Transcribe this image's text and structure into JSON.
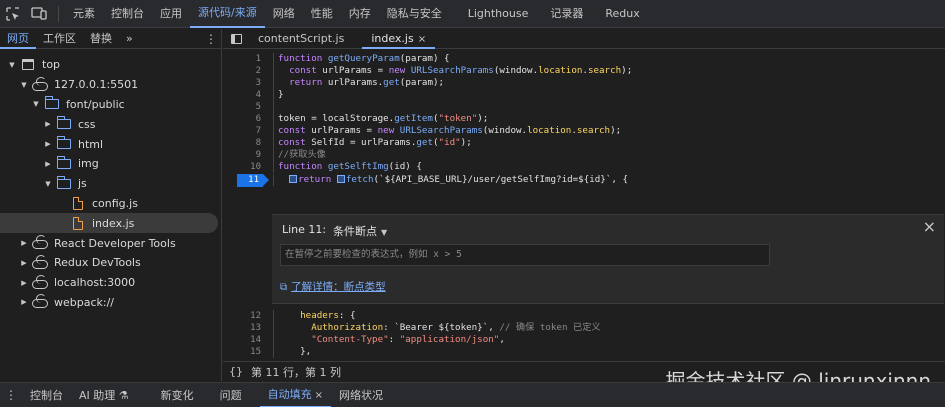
{
  "toolbar": {
    "tabs": [
      {
        "label": "元素"
      },
      {
        "label": "控制台"
      },
      {
        "label": "应用"
      },
      {
        "label": "源代码/来源"
      },
      {
        "label": "网络"
      },
      {
        "label": "性能"
      },
      {
        "label": "内存"
      },
      {
        "label": "隐私与安全"
      },
      {
        "label": "Lighthouse"
      },
      {
        "label": "记录器"
      },
      {
        "label": "Redux"
      }
    ],
    "active_tab": "源代码/来源",
    "icons": [
      "inspect-element-icon",
      "device-toolbar-icon"
    ]
  },
  "navigator": {
    "tabs": [
      {
        "label": "网页"
      },
      {
        "label": "工作区"
      },
      {
        "label": "替换"
      }
    ],
    "more_label": "»",
    "menu_label": "⋮",
    "tree": [
      {
        "label": "top",
        "icon": "frame-icon",
        "arrow": "down"
      },
      {
        "label": "127.0.0.1:5501",
        "icon": "cloud-icon",
        "arrow": "down"
      },
      {
        "label": "font/public",
        "icon": "folder-icon",
        "arrow": "down"
      },
      {
        "label": "css",
        "icon": "folder-icon",
        "arrow": "right"
      },
      {
        "label": "html",
        "icon": "folder-icon",
        "arrow": "right"
      },
      {
        "label": "img",
        "icon": "folder-icon",
        "arrow": "right"
      },
      {
        "label": "js",
        "icon": "folder-icon",
        "arrow": "down"
      },
      {
        "label": "config.js",
        "icon": "file-icon",
        "arrow": ""
      },
      {
        "label": "index.js",
        "icon": "file-icon",
        "arrow": "",
        "selected": true
      },
      {
        "label": "React Developer Tools",
        "icon": "cloud-icon",
        "arrow": "right"
      },
      {
        "label": "Redux DevTools",
        "icon": "cloud-icon",
        "arrow": "right"
      },
      {
        "label": "localhost:3000",
        "icon": "cloud-icon",
        "arrow": "right"
      },
      {
        "label": "webpack://",
        "icon": "cloud-icon",
        "arrow": "right"
      }
    ]
  },
  "editor": {
    "tabs": [
      {
        "label": "contentScript.js",
        "closable": false
      },
      {
        "label": "index.js",
        "closable": true,
        "active": true
      }
    ],
    "close_glyph": "×",
    "lines": [
      {
        "n": "1",
        "text": "function getQueryParam(param) {"
      },
      {
        "n": "2",
        "text": "  const urlParams = new URLSearchParams(window.location.search);"
      },
      {
        "n": "3",
        "text": "  return urlParams.get(param);"
      },
      {
        "n": "4",
        "text": "}"
      },
      {
        "n": "5",
        "text": ""
      },
      {
        "n": "6",
        "text": "token = localStorage.getItem(\"token\");"
      },
      {
        "n": "7",
        "text": "const urlParams = new URLSearchParams(window.location.search);"
      },
      {
        "n": "8",
        "text": "const SelfId = urlParams.get(\"id\");"
      },
      {
        "n": "9",
        "text": "//获取头像"
      },
      {
        "n": "10",
        "text": "function getSelftImg(id) {"
      },
      {
        "n": "11",
        "text": "  return fetch(`${API_BASE_URL}/user/getSelfImg?id=${id}`, {",
        "breakpoint": true
      },
      {
        "n": "12",
        "text": "    headers: {"
      },
      {
        "n": "13",
        "text": "      Authorization: `Bearer ${token}`, // 确保 token 已定义"
      },
      {
        "n": "14",
        "text": "      \"Content-Type\": \"application/json\","
      },
      {
        "n": "15",
        "text": "    },"
      }
    ],
    "breakpoint_editor": {
      "line_label": "Line 11:",
      "type_label": "条件断点",
      "placeholder": "在暂停之前要检查的表达式，例如 x > 5",
      "link_label": "了解详情：断点类型",
      "close_glyph": "×"
    },
    "status": {
      "braces": "{}",
      "position": "第 11 行，第 1 列"
    }
  },
  "watermark": "掘金技术社区 @ linrunxinnn",
  "drawer": {
    "tabs": [
      {
        "label": "控制台"
      },
      {
        "label": "AI 助理 ⚗"
      },
      {
        "label": "新变化"
      },
      {
        "label": "问题"
      },
      {
        "label": "自动填充",
        "active": true,
        "closable": true
      },
      {
        "label": "网络状况"
      }
    ],
    "menu_label": "⋮"
  },
  "colors": {
    "accent": "#7cacf8",
    "breakpoint": "#1a73e8",
    "background": "#1f1f1f",
    "toolbar": "#292a2d"
  }
}
